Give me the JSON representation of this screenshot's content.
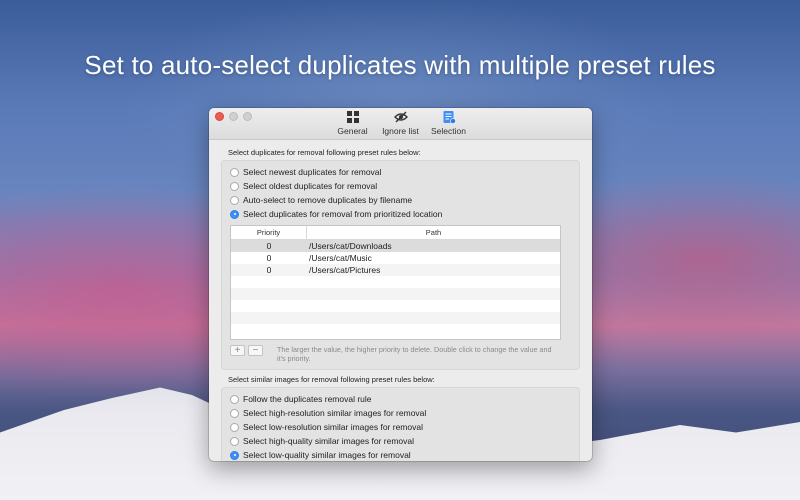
{
  "headline": "Set to auto-select duplicates with multiple preset rules",
  "toolbar": {
    "general": "General",
    "ignore_list": "Ignore list",
    "selection": "Selection"
  },
  "duplicates": {
    "label": "Select duplicates for removal following preset rules below:",
    "options": [
      "Select newest duplicates for removal",
      "Select oldest duplicates for removal",
      "Auto-select to remove duplicates by filename",
      "Select duplicates for removal from prioritized location"
    ],
    "selected_index": 3
  },
  "table": {
    "headers": {
      "priority": "Priority",
      "path": "Path"
    },
    "rows": [
      {
        "priority": "0",
        "path": "/Users/cat/Downloads"
      },
      {
        "priority": "0",
        "path": "/Users/cat/Music"
      },
      {
        "priority": "0",
        "path": "/Users/cat/Pictures"
      }
    ],
    "add": "+",
    "remove": "−",
    "hint": "The larger the value, the higher priority to delete.  Double click to change the value and it's priority."
  },
  "similar": {
    "label": "Select similar images for removal following preset rules below:",
    "options": [
      "Follow the duplicates removal rule",
      "Select high-resolution similar images for removal",
      "Select low-resolution similar images for removal",
      "Select high-quality similar images for removal",
      "Select low-quality similar images for removal"
    ],
    "selected_index": 4
  },
  "colors": {
    "accent": "#3f8ef6",
    "close": "#ee5b55"
  }
}
